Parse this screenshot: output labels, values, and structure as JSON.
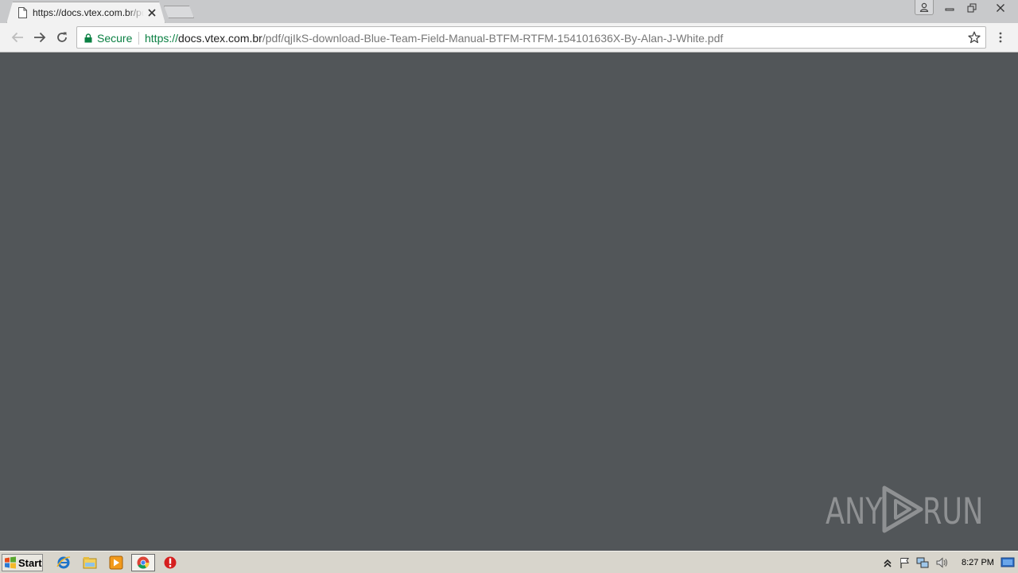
{
  "browser": {
    "tab_title": "https://docs.vtex.com.br/pdf/qjIkS-download-Blue-Team-Field-Manual-BTFM-RTFM-154101636X-By-Alan-J-White.pdf",
    "security_label": "Secure",
    "url_scheme": "https://",
    "url_host": "docs.vtex.com.br",
    "url_path": "/pdf/qjIkS-download-Blue-Team-Field-Manual-BTFM-RTFM-154101636X-By-Alan-J-White.pdf"
  },
  "watermark": {
    "left": "ANY",
    "right": "RUN"
  },
  "taskbar": {
    "start_label": "Start",
    "clock": "8:27 PM",
    "pinned": [
      "internet-explorer-icon",
      "file-explorer-icon",
      "media-player-icon",
      "chrome-icon",
      "security-warning-icon"
    ]
  },
  "colors": {
    "secure_green": "#0b8043",
    "content_bg": "#525659",
    "tabstrip_bg": "#c8c9cb"
  }
}
